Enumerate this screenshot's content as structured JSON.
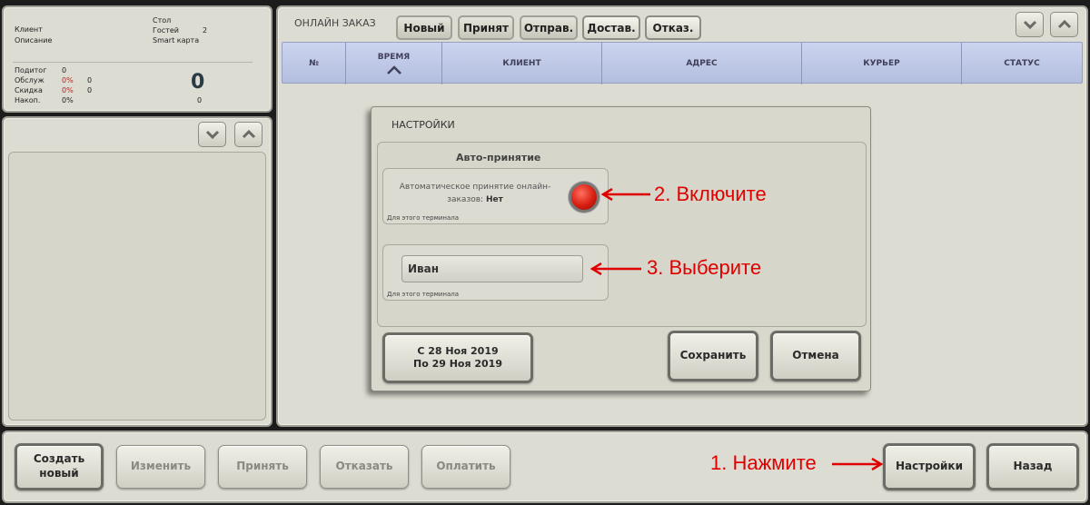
{
  "order_info": {
    "client_label": "Клиент",
    "description_label": "Описание",
    "table_label": "Стол",
    "guests_label": "Гостей",
    "guests_value": "2",
    "card_label": "Smart карта",
    "subtotal_label": "Подитог",
    "subtotal_value": "0",
    "service_label": "Обслуж",
    "service_pct": "0%",
    "service_value": "0",
    "discount_label": "Скидка",
    "discount_pct": "0%",
    "discount_value": "0",
    "accum_label": "Накоп.",
    "accum_pct": "0%",
    "accum_value": "0",
    "total": "0"
  },
  "online": {
    "title": "ОНЛАЙН ЗАКАЗ",
    "tabs": [
      {
        "label": "Новый"
      },
      {
        "label": "Принят"
      },
      {
        "label": "Отправ."
      },
      {
        "label": "Достав."
      },
      {
        "label": "Отказ."
      }
    ],
    "columns": [
      "№",
      "ВРЕМЯ",
      "КЛИЕНТ",
      "АДРЕС",
      "КУРЬЕР",
      "СТАТУС"
    ]
  },
  "settings_dialog": {
    "title": "НАСТРОЙКИ",
    "section_title": "Авто-принятие",
    "auto_text_line1": "Автоматическое принятие онлайн-",
    "auto_text_line2_prefix": "заказов: ",
    "auto_text_status": "Нет",
    "terminal_note_1": "Для этого терминала",
    "courier_value": "Иван",
    "terminal_note_2": "Для этого терминала",
    "date_from": "С 28 Ноя 2019",
    "date_to": "По 29 Ноя 2019",
    "save_label": "Сохранить",
    "cancel_label": "Отмена",
    "toggle_color": "#d81e10"
  },
  "toolbar": {
    "create_line1": "Создать",
    "create_line2": "новый",
    "edit_label": "Изменить",
    "accept_label": "Принять",
    "refuse_label": "Отказать",
    "pay_label": "Оплатить",
    "settings_label": "Настройки",
    "back_label": "Назад"
  },
  "annotations": {
    "step1": "1. Нажмите",
    "step2": "2. Включите",
    "step3": "3. Выберите",
    "color": "#e00000"
  }
}
